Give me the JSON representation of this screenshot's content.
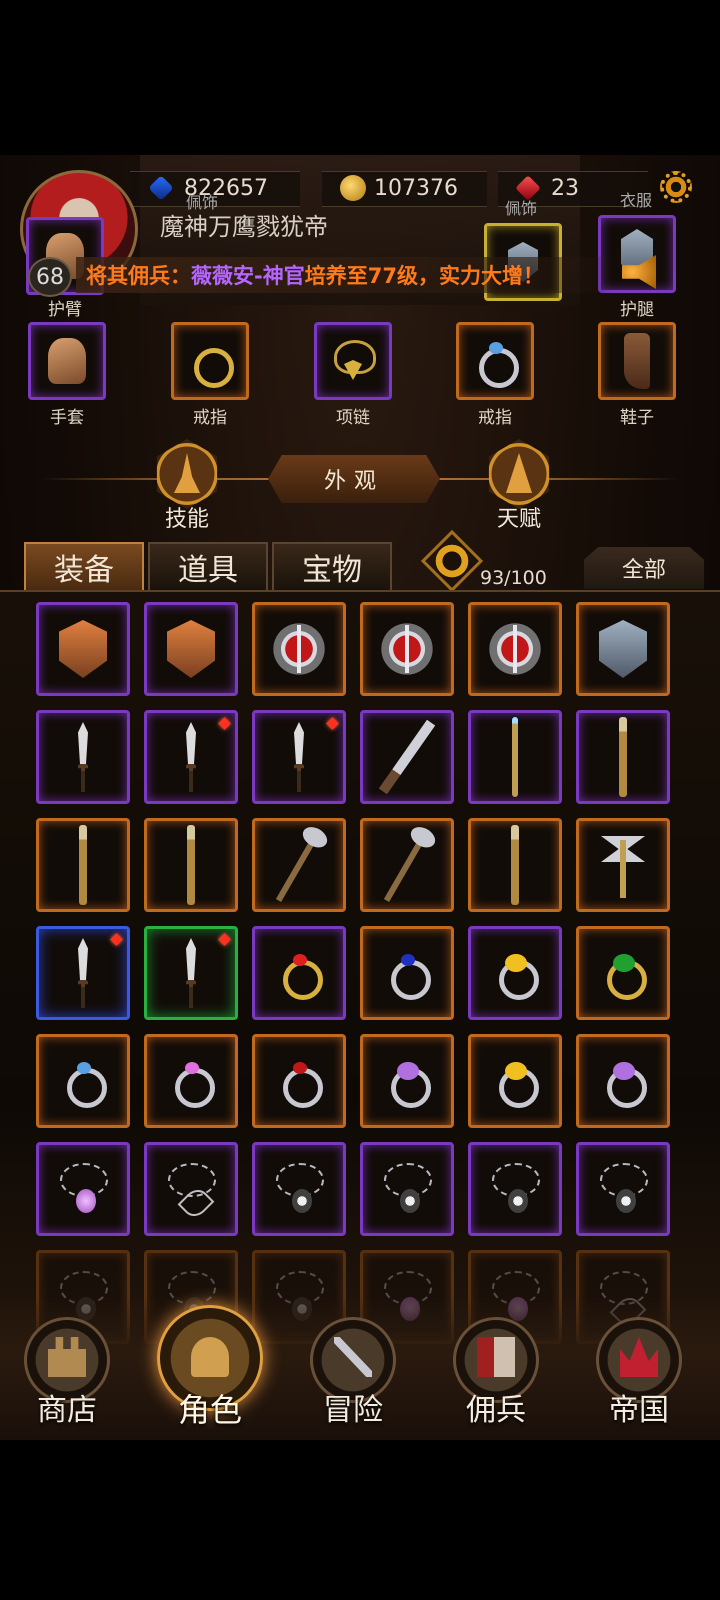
{
  "header": {
    "level": "68",
    "player_name": "魔神万鹰戮犹帝",
    "resources": {
      "crystal": "822657",
      "gold": "107376",
      "ruby": "23"
    },
    "announcement": {
      "part1": "将其佣兵：",
      "part2": "薇薇安-神官",
      "part3": "培养至77级，实力大增！"
    },
    "behind_labels": {
      "top_left": "佩饰",
      "top_right": "佩饰",
      "clothes": "衣服"
    }
  },
  "equipment": {
    "row1": [
      {
        "label": "护臂"
      },
      {
        "label": "护腿"
      }
    ],
    "row2": [
      {
        "label": "手套"
      },
      {
        "label": "戒指"
      },
      {
        "label": "项链"
      },
      {
        "label": "戒指"
      },
      {
        "label": "鞋子"
      }
    ]
  },
  "mid": {
    "skills": "技能",
    "appearance": "外观",
    "talent": "天赋"
  },
  "tabs": [
    {
      "label": "装备"
    },
    {
      "label": "道具"
    },
    {
      "label": "宝物"
    }
  ],
  "inventory": {
    "capacity": "93/100",
    "filter": "全部"
  },
  "nav": [
    {
      "label": "商店"
    },
    {
      "label": "角色"
    },
    {
      "label": "冒险"
    },
    {
      "label": "佣兵"
    },
    {
      "label": "帝国"
    }
  ],
  "colors": {
    "epic": "#7a3ac0",
    "orange": "#c06a20",
    "blue": "#3a5ae0",
    "green": "#2ab040",
    "accent": "#e0a040",
    "announce_orange": "#ff7a1a",
    "announce_purple": "#b466ff"
  }
}
